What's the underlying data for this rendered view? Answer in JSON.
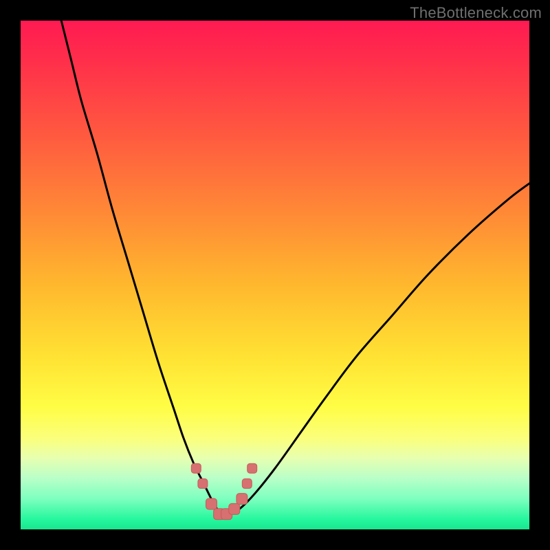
{
  "watermark": {
    "text": "TheBottleneck.com"
  },
  "colors": {
    "frame": "#000000",
    "curve": "#000000",
    "marker_fill": "#d77070",
    "marker_stroke": "#c85a5a",
    "gradient_top": "#ff1a52",
    "gradient_bottom": "#19e68e"
  },
  "chart_data": {
    "type": "line",
    "title": "",
    "xlabel": "",
    "ylabel": "",
    "xlim": [
      0,
      100
    ],
    "ylim": [
      0,
      100
    ],
    "grid": false,
    "series": [
      {
        "name": "bottleneck-curve",
        "x": [
          8,
          10,
          12,
          15,
          18,
          21,
          24,
          27,
          30,
          32,
          34,
          36,
          38,
          39.5,
          41,
          43,
          46,
          50,
          55,
          60,
          66,
          73,
          80,
          88,
          96,
          100
        ],
        "y": [
          100,
          92,
          84,
          74,
          63,
          53,
          43,
          33,
          24,
          18,
          13,
          9,
          5,
          3,
          3,
          4,
          7,
          12,
          19,
          26,
          34,
          42,
          50,
          58,
          65,
          68
        ]
      }
    ],
    "markers": {
      "name": "highlighted-points",
      "x": [
        34.5,
        35.8,
        37.5,
        39.0,
        40.5,
        42.0,
        43.5,
        44.5,
        45.5
      ],
      "y": [
        12,
        9,
        5,
        3,
        3,
        4,
        6,
        9,
        12
      ],
      "r": [
        7,
        7,
        8,
        8,
        8,
        8,
        8,
        7,
        7
      ]
    }
  }
}
